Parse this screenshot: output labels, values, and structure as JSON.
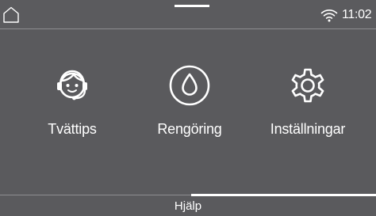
{
  "status_bar": {
    "time": "11:02",
    "home_icon": "home-icon",
    "wifi_icon": "wifi-icon"
  },
  "tiles": [
    {
      "label": "Tvättips",
      "icon": "support-agent-icon"
    },
    {
      "label": "Rengöring",
      "icon": "water-drop-icon"
    },
    {
      "label": "Inställningar",
      "icon": "gear-icon"
    }
  ],
  "help": {
    "label": "Hjälp"
  },
  "colors": {
    "background": "#5a5a5d",
    "foreground": "#ffffff",
    "divider": "#8e8e91"
  }
}
